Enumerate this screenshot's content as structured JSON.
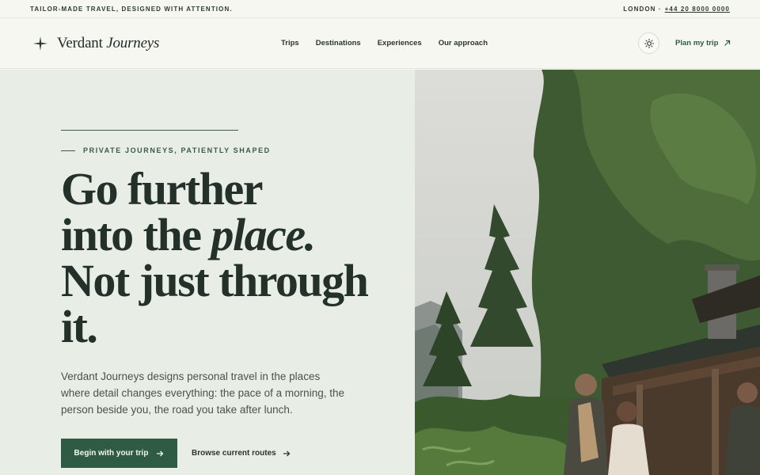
{
  "topbar": {
    "tagline": "TAILOR-MADE TRAVEL, DESIGNED WITH ATTENTION.",
    "city": "LONDON ·",
    "phone": "+44 20 8000 0000"
  },
  "header": {
    "brand_regular": "Verdant ",
    "brand_italic": "Journeys",
    "nav": [
      "Trips",
      "Destinations",
      "Experiences",
      "Our approach"
    ],
    "theme_icon": "sun-icon",
    "plan_label": "Plan my trip",
    "plan_icon": "arrow-up-right-icon"
  },
  "hero": {
    "eyebrow": "PRIVATE JOURNEYS, PATIENTLY SHAPED",
    "headline_1": "Go further",
    "headline_2a": "into the ",
    "headline_2b": "place.",
    "headline_3": "Not just through",
    "headline_4": "it.",
    "body": "Verdant Journeys designs personal travel in the places where detail changes everything: the pace of a morning, the person beside you, the road you take after lunch.",
    "primary_label": "Begin with your trip",
    "secondary_label": "Browse current routes"
  },
  "colors": {
    "accent": "#2f5b45",
    "hero_bg": "#e8eee6",
    "page_bg": "#f7f7f2"
  }
}
